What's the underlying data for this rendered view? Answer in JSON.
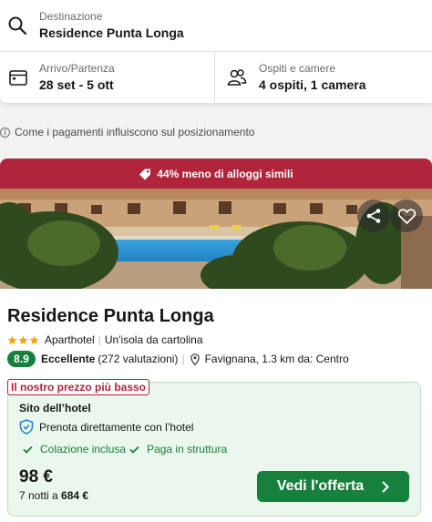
{
  "search": {
    "destination_label": "Destinazione",
    "destination_value": "Residence Punta Longa",
    "dates_label": "Arrivo/Partenza",
    "dates_value": "28 set - 5 ott",
    "guests_label": "Ospiti e camere",
    "guests_value": "4 ospiti, 1 camera"
  },
  "info_note": "Come i pagamenti influiscono sul posizionamento",
  "deal_banner": "44% meno di alloggi simili",
  "hotel": {
    "name": "Residence Punta Longa",
    "star_count": 3,
    "type": "Aparthotel",
    "tagline": "Un'isola da cartolina",
    "score": "8.9",
    "score_label": "Eccellente",
    "reviews": "(272 valutazioni)",
    "location": "Favignana, 1.3 km da: Centro"
  },
  "offer": {
    "badge": "Il nostro prezzo più basso",
    "provider": "Sito dell’hotel",
    "direct_note": "Prenota direttamente con l’hotel",
    "perk_1": "Colazione inclusa",
    "perk_2": "Paga in struttura",
    "price": "98 €",
    "nights_prefix": "7 notti a",
    "nights_total": "684 €",
    "cta_label": "Vedi l'offerta"
  },
  "colors": {
    "deal_red": "#b0243c",
    "rating_green": "#16803c",
    "offer_bg": "#ebf7ec",
    "star_gold": "#f2a516"
  },
  "icons": [
    "search-icon",
    "calendar-icon",
    "guests-icon",
    "info-icon",
    "tag-icon",
    "share-icon",
    "heart-icon",
    "star-icon",
    "location-pin-icon",
    "shield-check-icon",
    "check-icon",
    "chevron-right-icon"
  ]
}
